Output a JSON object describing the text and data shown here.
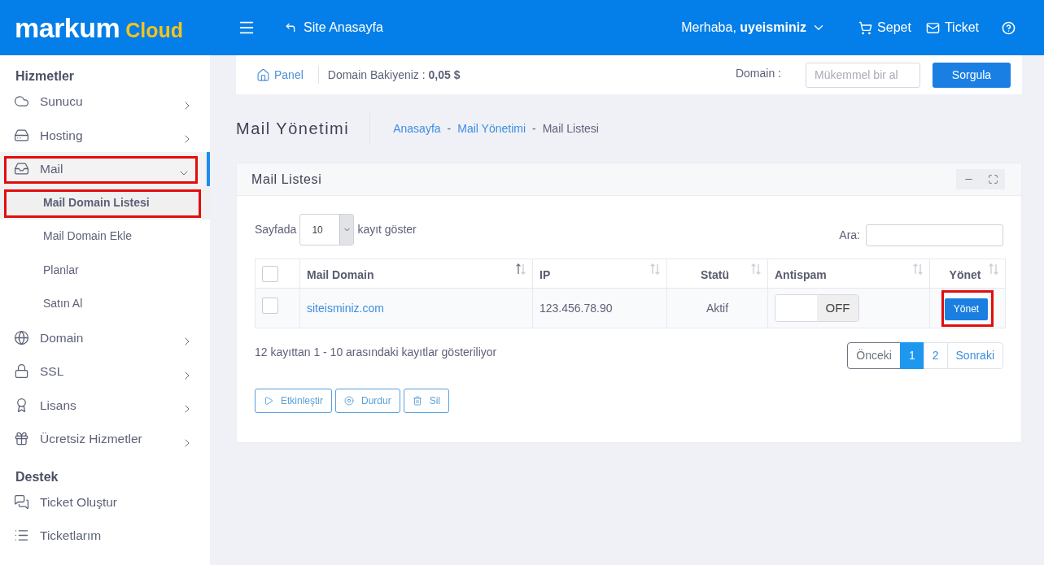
{
  "header": {
    "logo": {
      "word": "markum",
      "accent": "Cloud"
    },
    "home_link": "Site Anasayfa",
    "greeting": "Merhaba, **uyeisminiz**",
    "links": [
      {
        "label": "Sepet"
      },
      {
        "label": "Ticket"
      }
    ]
  },
  "sidebar": {
    "sections": [
      {
        "title": "Hizmetler",
        "items": [
          {
            "label": "Sunucu",
            "selected": false,
            "expanded": false,
            "highlighted": false
          },
          {
            "label": "Hosting",
            "selected": false,
            "expanded": false,
            "highlighted": false
          },
          {
            "label": "Mail",
            "selected": true,
            "expanded": true,
            "highlighted": true,
            "children": [
              {
                "label": "Mail Domain Listesi",
                "selected": true,
                "highlighted": true
              },
              {
                "label": "Mail Domain Ekle",
                "selected": false,
                "highlighted": false
              },
              {
                "label": "Planlar",
                "selected": false,
                "highlighted": false
              },
              {
                "label": "Satın Al",
                "selected": false,
                "highlighted": false
              }
            ]
          },
          {
            "label": "Domain",
            "selected": false,
            "expanded": false,
            "highlighted": false
          },
          {
            "label": "SSL",
            "selected": false,
            "expanded": false,
            "highlighted": false
          },
          {
            "label": "Lisans",
            "selected": false,
            "expanded": false,
            "highlighted": false
          },
          {
            "label": "Ücretsiz Hizmetler",
            "selected": false,
            "expanded": false,
            "highlighted": false
          }
        ]
      },
      {
        "title": "Destek",
        "items": [
          {
            "label": "Ticket Oluştur",
            "selected": false,
            "highlighted": false
          },
          {
            "label": "Ticketlarım",
            "selected": false,
            "highlighted": false
          }
        ]
      }
    ]
  },
  "top_bar": {
    "panel_link": "Panel",
    "balance": "Domain Bakiyeniz : **0,05 $**",
    "domain_label": "Domain :",
    "domain_search": {
      "placeholder": "Mükemmel bir al"
    },
    "query_button": "Sorgula"
  },
  "page": {
    "title": "Mail Yönetimi",
    "breadcrumbs": [
      {
        "label": "Anasayfa",
        "link": true
      },
      {
        "separator": "-",
        "label": "Mail Yönetimi",
        "link": true
      },
      {
        "separator": "-",
        "label": "Mail Listesi",
        "link": false
      }
    ]
  },
  "card": {
    "title": "Mail Listesi",
    "length": {
      "prefix": "Sayfada",
      "value": "10",
      "suffix": "kayıt göster"
    },
    "search": {
      "label": "Ara:"
    },
    "table": {
      "columns": [
        {
          "kind": "select",
          "checked": false
        },
        {
          "kind": "domain",
          "label": "Mail Domain",
          "sorted": true
        },
        {
          "kind": "ip",
          "label": "IP",
          "sorted": false
        },
        {
          "kind": "status",
          "label": "Statü",
          "sorted": false
        },
        {
          "kind": "antispam",
          "label": "Antispam",
          "sorted": false
        },
        {
          "kind": "action",
          "label": "Yönet",
          "sorted": false
        }
      ],
      "rows": [
        {
          "select": {
            "checked": false
          },
          "domain": "siteisminiz.com",
          "ip": "123.456.78.90",
          "status": "Aktif",
          "antispam": {
            "on": false,
            "label": "OFF"
          },
          "action": {
            "label": "Yönet",
            "highlighted": true
          }
        }
      ]
    },
    "info": "12 kayıttan 1 - 10 arasındaki kayıtlar gösteriliyor",
    "pagination": [
      {
        "label": "Önceki",
        "selected": false,
        "disabled": true
      },
      {
        "label": "1",
        "selected": true,
        "disabled": false
      },
      {
        "label": "2",
        "selected": false,
        "disabled": false
      },
      {
        "label": "Sonraki",
        "selected": false,
        "disabled": false
      }
    ],
    "actions": [
      {
        "label": "Etkinleştir"
      },
      {
        "label": "Durdur"
      },
      {
        "label": "Sil"
      }
    ]
  }
}
